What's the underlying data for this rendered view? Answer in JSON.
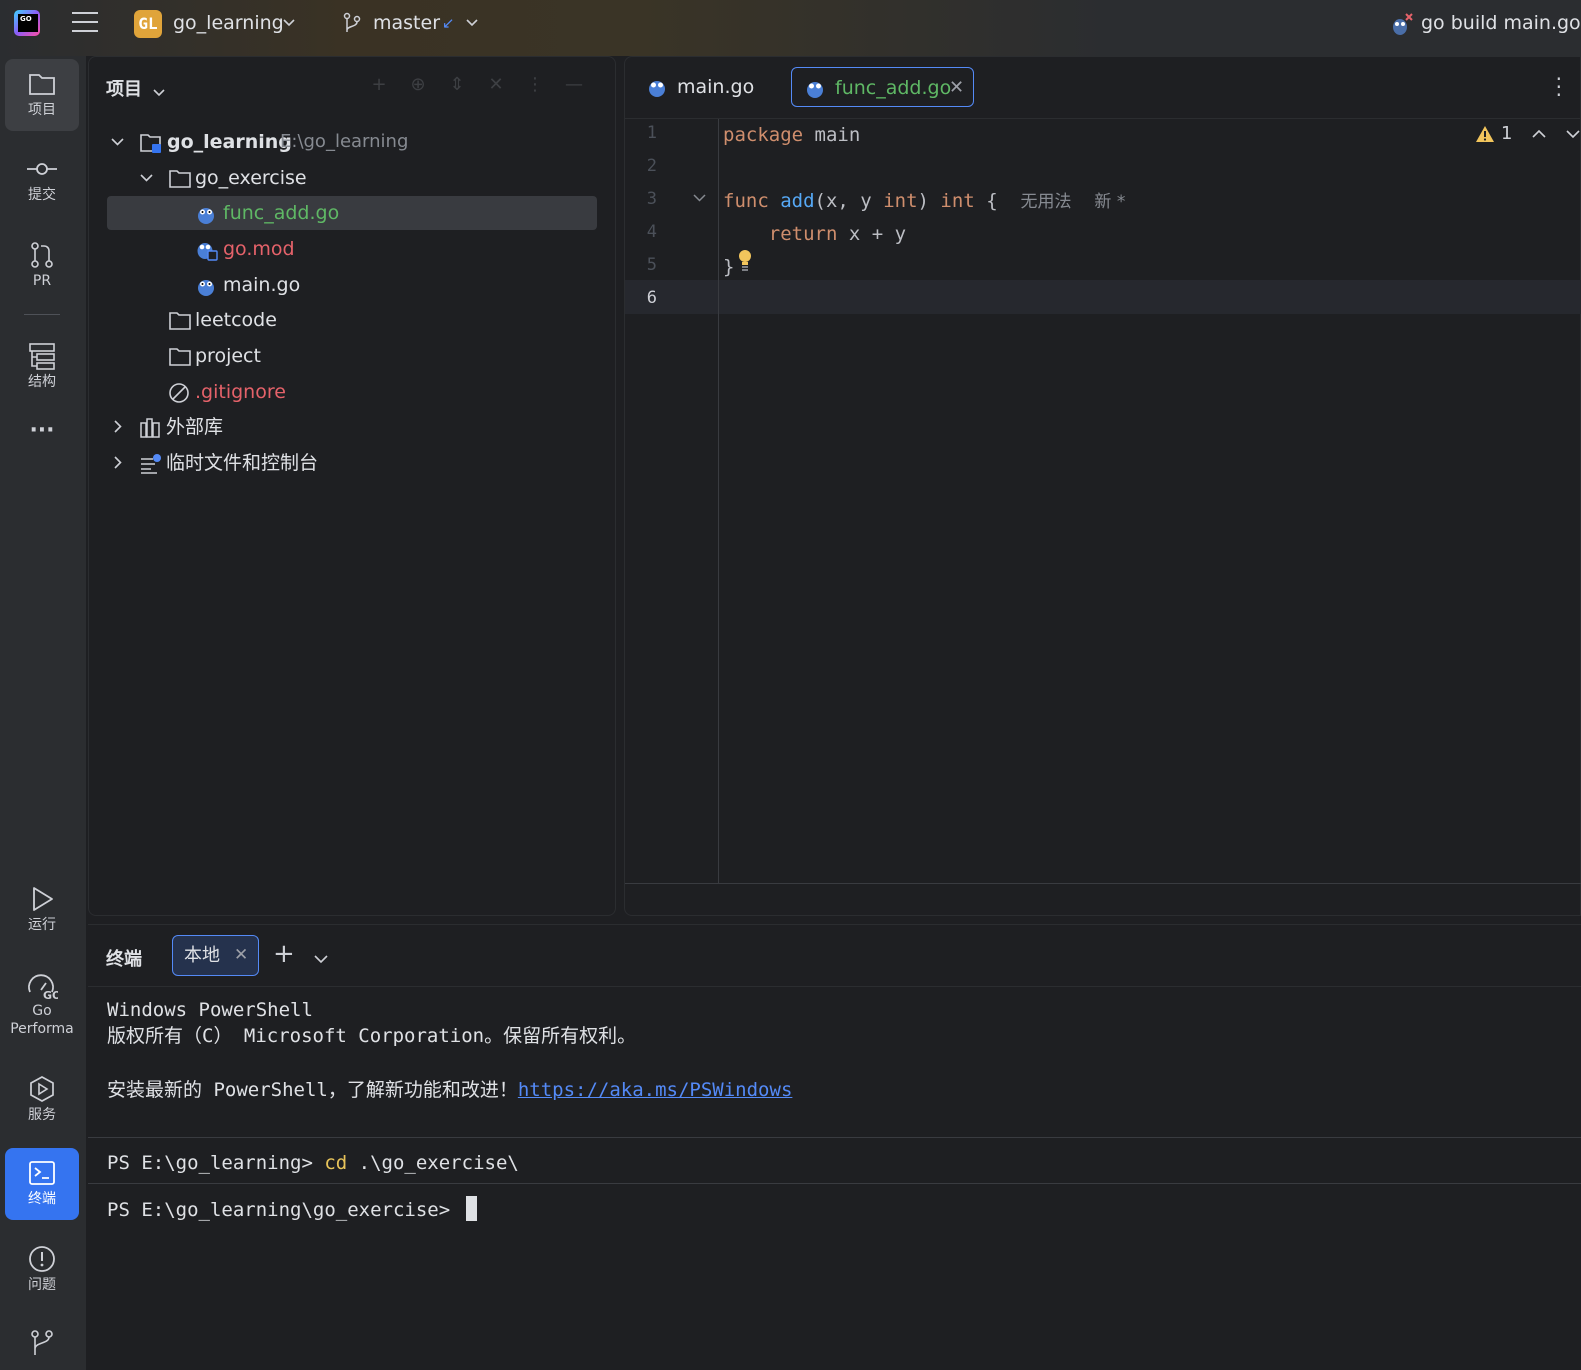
{
  "titlebar": {
    "project_badge": "GL",
    "project_name": "go_learning",
    "branch_name": "master",
    "run_config": "go build main.go"
  },
  "toolstrip": {
    "project": "项目",
    "commit": "提交",
    "pr": "PR",
    "structure": "结构",
    "more": "···",
    "run": "运行",
    "go_perf_1": "Go",
    "go_perf_2": "Performa",
    "services": "服务",
    "terminal": "终端",
    "problems": "问题"
  },
  "project_panel": {
    "title": "项目",
    "tree": {
      "root_name": "go_learning",
      "root_path": "E:\\go_learning",
      "go_exercise": "go_exercise",
      "func_add": "func_add.go",
      "go_mod": "go.mod",
      "main_go": "main.go",
      "leetcode": "leetcode",
      "project": "project",
      "gitignore": ".gitignore",
      "external_libs": "外部库",
      "scratches": "临时文件和控制台"
    }
  },
  "editor": {
    "tabs": [
      {
        "label": "main.go"
      },
      {
        "label": "func_add.go"
      }
    ],
    "line_numbers": [
      "1",
      "2",
      "3",
      "4",
      "5",
      "6"
    ],
    "code": {
      "l1_kw": "package",
      "l1_name": " main",
      "l3_kw": "func",
      "l3_fn": " add",
      "l3_params_open": "(x, ",
      "l3_y": "y",
      "l3_space": " ",
      "l3_int1": "int",
      "l3_close": ") ",
      "l3_int2": "int",
      "l3_brace": " {",
      "l3_hint_usage": "无用法",
      "l3_hint_new": "新 *",
      "l4_indent": "    ",
      "l4_kw": "return",
      "l4_expr": " x + y",
      "l5": "}"
    },
    "warning_count": "1"
  },
  "terminal": {
    "title": "终端",
    "tab_label": "本地",
    "lines": {
      "l1": "Windows PowerShell",
      "l2": "版权所有（C） Microsoft Corporation。保留所有权利。",
      "l3_text": "安装最新的 PowerShell，了解新功能和改进！",
      "l3_link": "https://aka.ms/PSWindows",
      "l4_prompt": "PS E:\\go_learning> ",
      "l4_cmd": "cd",
      "l4_arg": " .\\go_exercise\\",
      "l5_prompt": "PS E:\\go_learning\\go_exercise> "
    }
  },
  "colors": {
    "accent": "#3574f0",
    "file_modified": "#5fb865",
    "file_untracked": "#e5626a",
    "keyword": "#cf8e6d",
    "function": "#56a8f5"
  }
}
